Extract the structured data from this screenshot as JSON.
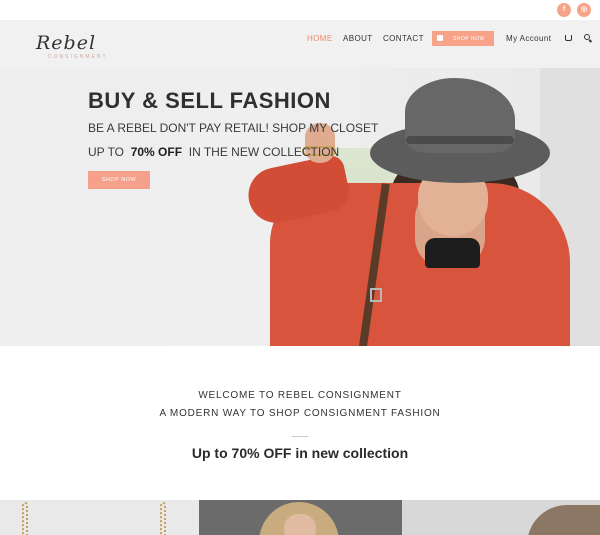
{
  "social": {
    "facebook_glyph": "f",
    "instagram_glyph": "◎",
    "accent": "#f6a38a"
  },
  "header": {
    "logo_script": "Rebel",
    "logo_sub": "CONSIGNMENT",
    "nav": {
      "home": "HOME",
      "about": "ABOUT",
      "contact": "CONTACT",
      "shop_now": "SHOP NOW",
      "account": "My Account"
    },
    "active_color": "#f08a6c"
  },
  "hero": {
    "title": "BUY & SELL  FASHION",
    "subtitle": "BE A REBEL DON'T PAY RETAIL! SHOP MY CLOSET",
    "promo_prefix": "UP TO",
    "promo_bold": "70% OFF",
    "promo_suffix": "IN THE NEW COLLECTION",
    "button": "SHOP NOW"
  },
  "welcome": {
    "line1": "WELCOME TO REBEL CONSIGNMENT",
    "line2": "A MODERN WAY TO SHOP CONSIGNMENT FASHION",
    "headline": "Up to 70% OFF in new collection"
  }
}
